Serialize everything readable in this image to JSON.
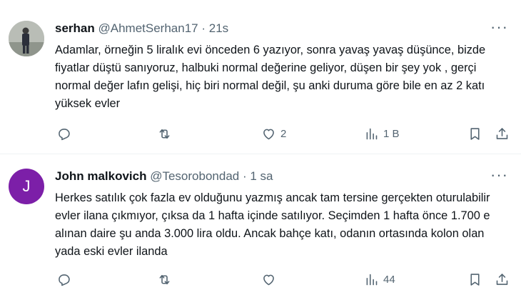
{
  "tweets": [
    {
      "name": "serhan",
      "handle": "@AhmetSerhan17",
      "separator": "·",
      "time": "21s",
      "more_label": "···",
      "text": "Adamlar, örneğin 5 liralık evi önceden 6 yazıyor, sonra yavaş yavaş düşünce, bizde fiyatlar düştü sanıyoruz, halbuki normal değerine geliyor, düşen bir şey yok , gerçi normal değer lafın gelişi, hiç biri normal değil, şu anki duruma göre bile en az 2 katı yüksek evler",
      "like_count": "2",
      "views_count": "1 B",
      "icons": [
        "reply-icon",
        "retweet-icon",
        "like-icon",
        "views-icon",
        "bookmark-icon",
        "share-icon"
      ]
    },
    {
      "name": "John malkovich",
      "handle": "@Tesorobondad",
      "separator": "·",
      "time": "1 sa",
      "avatar_letter": "J",
      "more_label": "···",
      "text": "Herkes satılık çok fazla ev olduğunu yazmış ancak tam tersine gerçekten oturulabilir evler ilana çıkmıyor,  çıksa da 1 hafta içinde satılıyor. Seçimden 1 hafta önce 1.700 e alınan daire şu anda 3.000 lira oldu. Ancak bahçe katı, odanın ortasında kolon olan yada eski evler ilanda",
      "views_count": "44",
      "icons": [
        "reply-icon",
        "retweet-icon",
        "like-icon",
        "views-icon",
        "bookmark-icon",
        "share-icon"
      ]
    }
  ],
  "colors": {
    "text": "#0f1419",
    "secondary": "#536471",
    "divider": "#eff3f4",
    "avatar_purple": "#7c1fa8"
  }
}
